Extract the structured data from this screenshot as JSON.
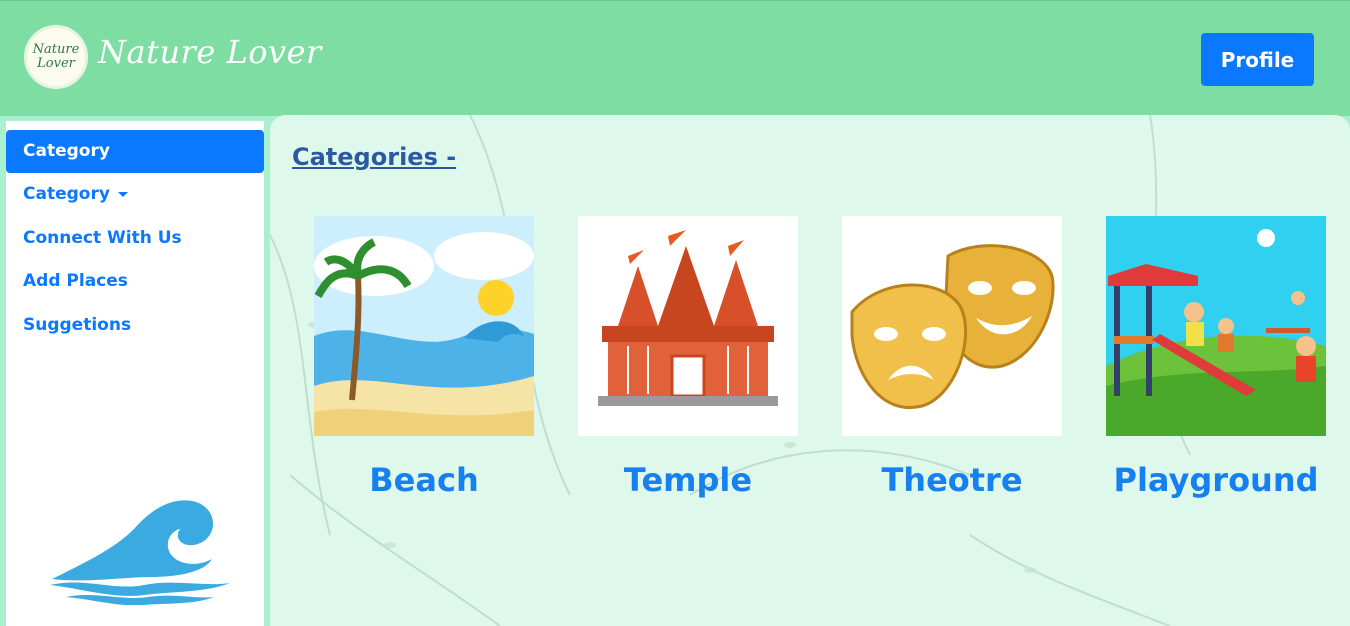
{
  "header": {
    "logo_text_line1": "Nature",
    "logo_text_line2": "Lover",
    "brand": "Nature Lover",
    "profile_label": "Profile"
  },
  "sidebar": {
    "active_item": "Category",
    "items": [
      {
        "label": "Category",
        "dropdown": true
      },
      {
        "label": "Connect With Us"
      },
      {
        "label": "Add Places"
      },
      {
        "label": "Suggetions"
      }
    ],
    "bottom_icon": "wave-icon"
  },
  "main": {
    "title": "Categories -",
    "cards": [
      {
        "label": "Beach",
        "icon": "beach-image"
      },
      {
        "label": "Temple",
        "icon": "temple-image"
      },
      {
        "label": "Theotre",
        "icon": "theatre-masks-image"
      },
      {
        "label": "Playground",
        "icon": "playground-image"
      }
    ]
  },
  "colors": {
    "header_bg": "#7edda3",
    "accent": "#0a78ff",
    "content_bg": "#dff8ec",
    "link": "#1680f0"
  }
}
